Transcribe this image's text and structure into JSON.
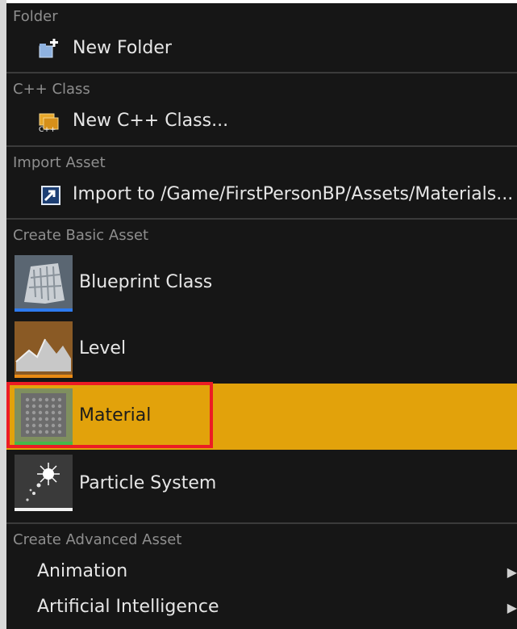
{
  "menu": {
    "sections": {
      "folder": {
        "header": "Folder",
        "new_folder": "New Folder",
        "icon": "new-folder-icon"
      },
      "cpp": {
        "header": "C++ Class",
        "new_cpp_class": "New C++ Class...",
        "icon": "cpp-class-icon"
      },
      "import": {
        "header": "Import Asset",
        "import_to": "Import to /Game/FirstPersonBP/Assets/Materials...",
        "icon": "import-icon"
      },
      "basic": {
        "header": "Create Basic Asset",
        "items": [
          {
            "label": "Blueprint Class",
            "icon": "blueprint-class-icon"
          },
          {
            "label": "Level",
            "icon": "level-icon"
          },
          {
            "label": "Material",
            "icon": "material-icon",
            "highlighted": true
          },
          {
            "label": "Particle System",
            "icon": "particle-system-icon"
          }
        ]
      },
      "advanced": {
        "header": "Create Advanced Asset",
        "items": [
          {
            "label": "Animation",
            "icon": "submenu-arrow-icon"
          },
          {
            "label": "Artificial Intelligence",
            "icon": "submenu-arrow-icon"
          }
        ]
      }
    },
    "colors": {
      "menu_bg": "#161616",
      "highlight": "#e2a20b",
      "annotation_box": "#ec1c24"
    }
  }
}
